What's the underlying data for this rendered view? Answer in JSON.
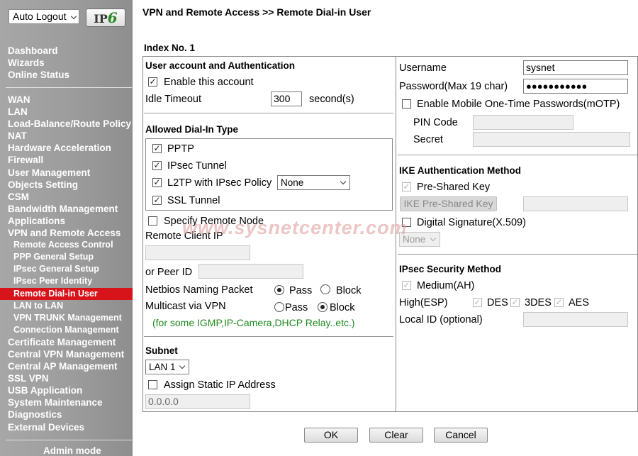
{
  "sidebar": {
    "auto_logout": "Auto Logout",
    "ipv6_badge_ip": "IP",
    "ipv6_badge_6": "6",
    "group1": [
      "Dashboard",
      "Wizards",
      "Online Status"
    ],
    "group2": [
      "WAN",
      "LAN",
      "Load-Balance/Route Policy",
      "NAT",
      "Hardware Acceleration",
      "Firewall",
      "User Management",
      "Objects Setting",
      "CSM",
      "Bandwidth Management",
      "Applications",
      "VPN and Remote Access"
    ],
    "vpn_sub": [
      "Remote Access Control",
      "PPP General Setup",
      "IPsec General Setup",
      "IPsec Peer Identity",
      "Remote Dial-in User",
      "LAN to LAN",
      "VPN TRUNK Management",
      "Connection Management"
    ],
    "active_item": "Remote Dial-in User",
    "group3": [
      "Certificate Management",
      "Central VPN Management",
      "Central AP Management",
      "SSL VPN",
      "USB Application",
      "System Maintenance",
      "Diagnostics",
      "External Devices"
    ],
    "admin_mode": "Admin mode",
    "active_color": "#d6141a"
  },
  "page": {
    "title": "VPN and Remote Access >> Remote Dial-in User",
    "index_no": "Index No. 1",
    "watermark": "www.sysnetcenter.com"
  },
  "user_account": {
    "heading": "User account and Authentication",
    "enable_label": "Enable this account",
    "enable_checked": true,
    "idle_label": "Idle Timeout",
    "idle_value": "300",
    "idle_unit": "second(s)"
  },
  "dialin": {
    "heading": "Allowed Dial-In Type",
    "pptp": "PPTP",
    "ipsec": "IPsec Tunnel",
    "l2tp": "L2TP with IPsec Policy",
    "l2tp_policy": "None",
    "ssl": "SSL Tunnel"
  },
  "remote": {
    "specify_label": "Specify Remote Node",
    "client_ip_label": "Remote Client IP",
    "peer_id_label": "or Peer ID",
    "netbios_label": "Netbios Naming Packet",
    "multicast_label": "Multicast via VPN",
    "pass": "Pass",
    "block": "Block",
    "netbios_selected": "Pass",
    "multicast_selected": "Block",
    "note": "(for some IGMP,IP-Camera,DHCP Relay..etc.)"
  },
  "subnet": {
    "heading": "Subnet",
    "value": "LAN 1",
    "assign_static_label": "Assign Static IP Address",
    "static_ip": "0.0.0.0"
  },
  "credentials": {
    "username_label": "Username",
    "username_value": "sysnet",
    "password_label": "Password(Max 19 char)",
    "password_value": "●●●●●●●●●●●",
    "motp_label": "Enable Mobile One-Time Passwords(mOTP)",
    "pin_label": "PIN Code",
    "secret_label": "Secret"
  },
  "ike": {
    "heading": "IKE Authentication Method",
    "psk_label": "Pre-Shared Key",
    "psk_button": "IKE Pre-Shared Key",
    "digital_sig_label": "Digital Signature(X.509)",
    "sig_select": "None"
  },
  "ipsec": {
    "heading": "IPsec Security Method",
    "medium_label": "Medium(AH)",
    "high_label": "High(ESP)",
    "des": "DES",
    "des3": "3DES",
    "aes": "AES",
    "local_id_label": "Local ID (optional)"
  },
  "buttons": {
    "ok": "OK",
    "clear": "Clear",
    "cancel": "Cancel"
  }
}
